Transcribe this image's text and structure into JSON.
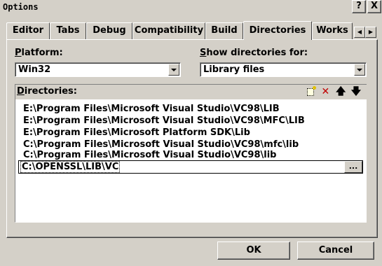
{
  "window": {
    "title": "Options",
    "help_label": "?",
    "close_label": "X"
  },
  "tabs": [
    {
      "label": "Editor",
      "selected": false
    },
    {
      "label": "Tabs",
      "selected": false
    },
    {
      "label": "Debug",
      "selected": false
    },
    {
      "label": "Compatibility",
      "selected": false
    },
    {
      "label": "Build",
      "selected": false
    },
    {
      "label": "Directories",
      "selected": true
    },
    {
      "label": "Works",
      "selected": false
    }
  ],
  "tab_scroll": {
    "left": "◀",
    "right": "▶"
  },
  "platform": {
    "label_mnemonic": "P",
    "label_rest": "latform:",
    "value": "Win32"
  },
  "show_directories": {
    "label_mnemonic": "S",
    "label_rest": "how directories for:",
    "value": "Library files"
  },
  "directories": {
    "label_mnemonic": "D",
    "label_rest": "irectories:",
    "toolbar": {
      "delete_label": "✕",
      "move_up_label": "🡅",
      "move_down_label": "🡇"
    },
    "items": [
      "E:\\Program Files\\Microsoft Visual Studio\\VC98\\LIB",
      "E:\\Program Files\\Microsoft Visual Studio\\VC98\\MFC\\LIB",
      "E:\\Program Files\\Microsoft Platform SDK\\Lib",
      "C:\\Program Files\\Microsoft Visual Studio\\VC98\\mfc\\lib",
      "C:\\Program Files\\Microsoft Visual Studio\\VC98\\lib"
    ],
    "edit_value": "C:\\OPENSSL\\LIB\\VC",
    "browse_label": "..."
  },
  "buttons": {
    "ok_label": "OK",
    "cancel_label": "Cancel"
  }
}
